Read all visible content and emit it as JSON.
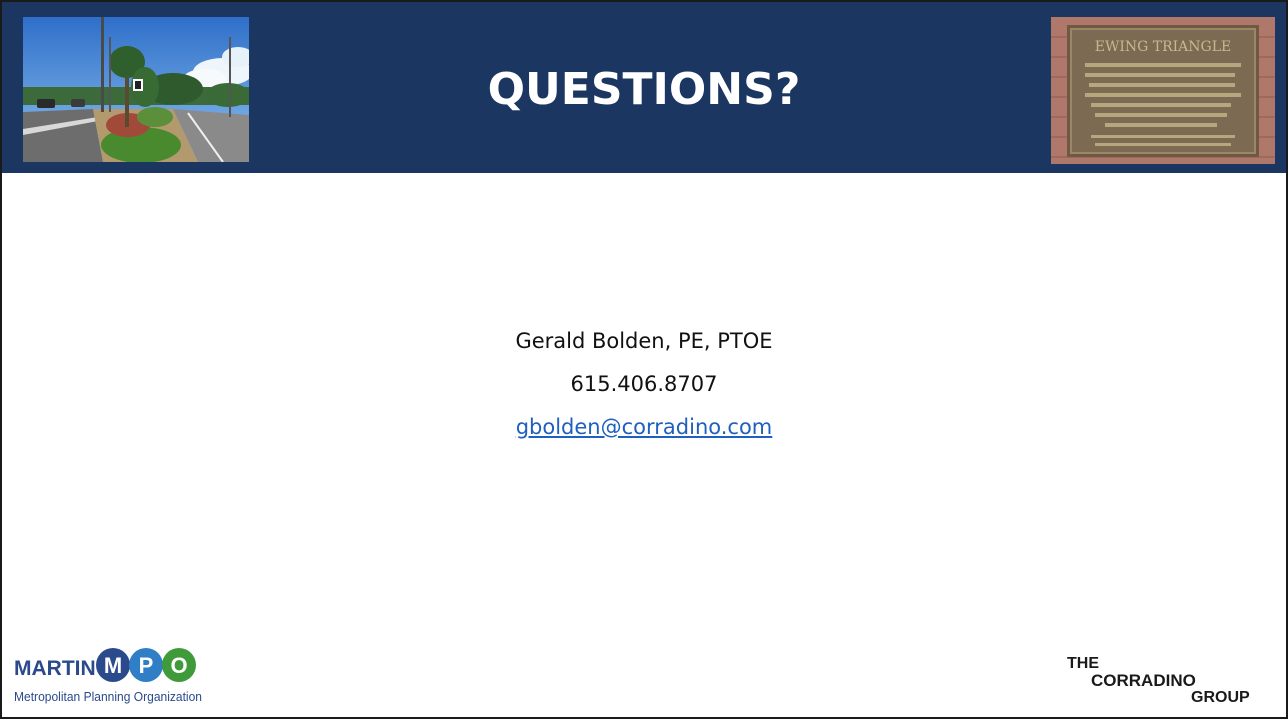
{
  "slide": {
    "title": "QUESTIONS?"
  },
  "contact": {
    "name": "Gerald Bolden, PE, PTOE",
    "phone": "615.406.8707",
    "email": "gbolden@corradino.com"
  },
  "logos": {
    "martin": {
      "word": "MARTIN",
      "letters": [
        "M",
        "P",
        "O"
      ],
      "subtitle": "Metropolitan Planning Organization",
      "colors": {
        "word": "#2a4a8c",
        "m": "#2a4a8c",
        "p": "#2f7ec6",
        "o": "#3f9b3a",
        "subtitle": "#2a4a8c"
      }
    },
    "corradino": {
      "line1": "THE",
      "line2": "CORRADINO",
      "line3": "GROUP",
      "color": "#1a1a1a"
    }
  },
  "photos": {
    "left_icon": "roadside-photo",
    "right_icon": "historical-plaque-photo",
    "plaque_title": "EWING TRIANGLE"
  },
  "colors": {
    "header_bg": "#1b3660",
    "title": "#ffffff",
    "link": "#1f5fbf"
  }
}
